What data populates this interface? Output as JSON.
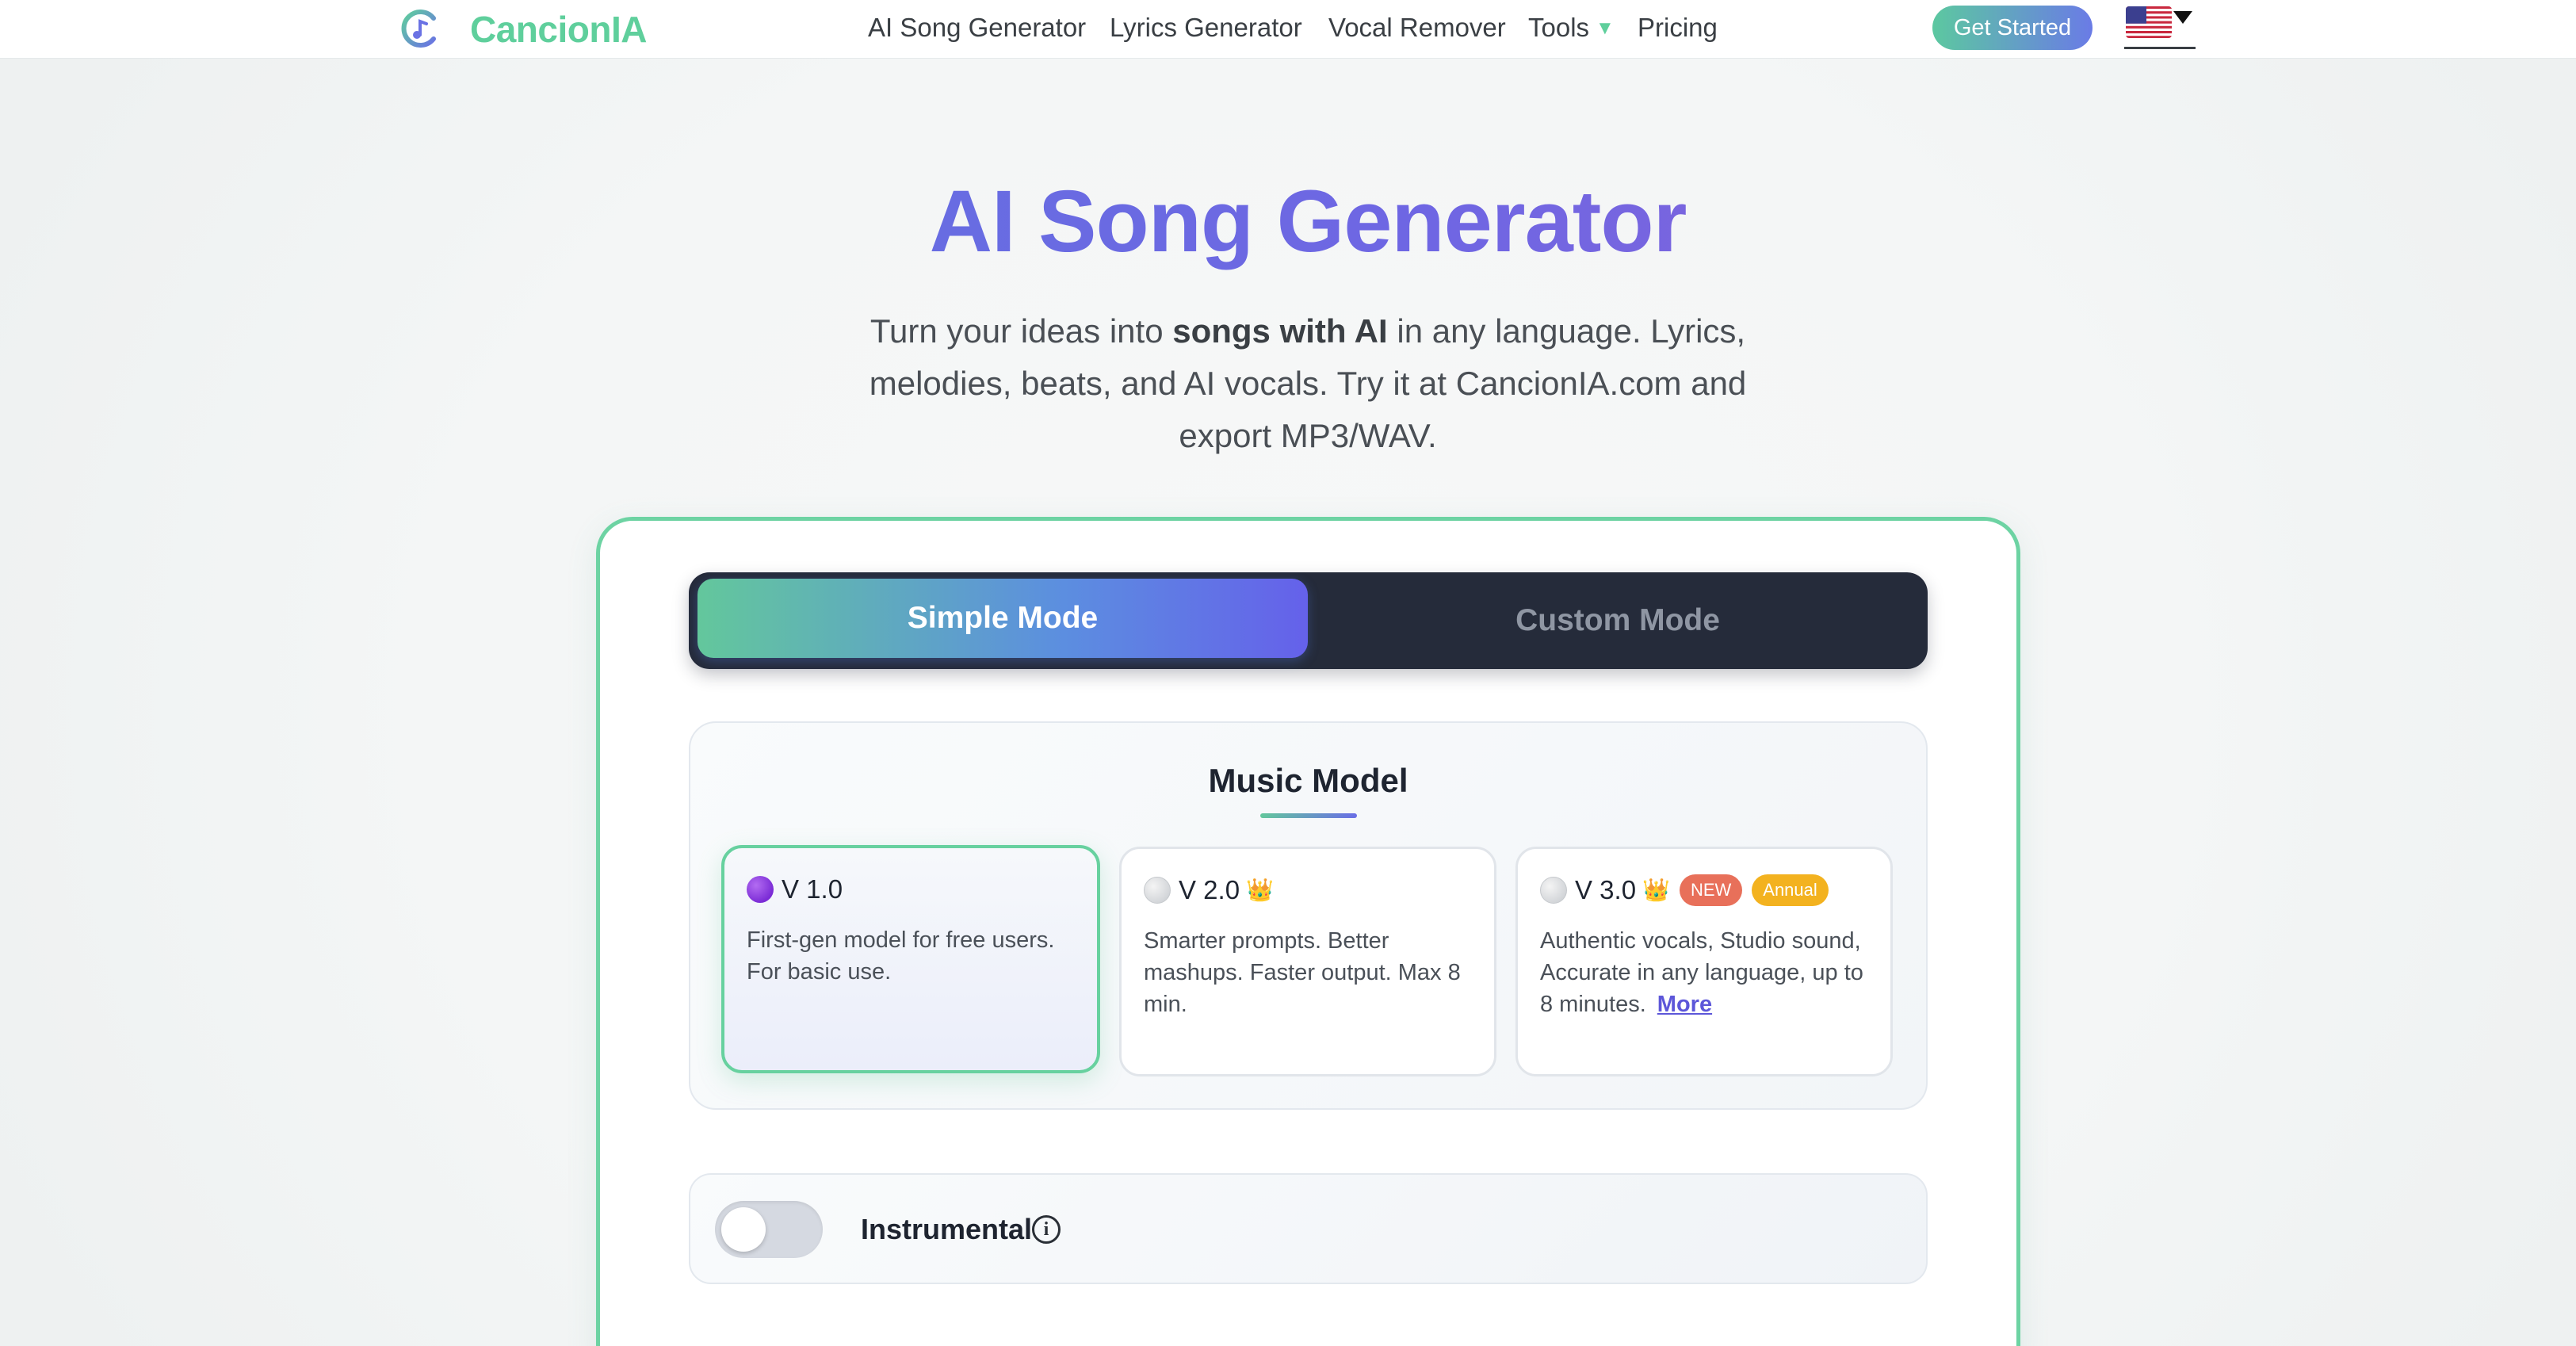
{
  "header": {
    "brand": "CancionIA",
    "nav": [
      "AI Song Generator",
      "Lyrics Generator",
      "Vocal Remover",
      "Tools",
      "Pricing"
    ],
    "cta": "Get Started",
    "language_icon": "us-flag-icon"
  },
  "hero": {
    "title": "AI Song Generator",
    "sub_part1": "Turn your ideas into ",
    "sub_bold": "songs with AI",
    "sub_part2": " in any language. Lyrics, melodies, beats, and AI vocals. Try it at CancionIA.com and export MP3/WAV."
  },
  "mode": {
    "simple": "Simple Mode",
    "custom": "Custom Mode",
    "selected": "Simple Mode"
  },
  "music_model": {
    "heading": "Music Model",
    "models": [
      {
        "name": "V 1.0",
        "desc": "First-gen model for free users. For basic use.",
        "selected": true
      },
      {
        "name": "V 2.0",
        "desc": "Smarter prompts. Better mashups. Faster output. Max 8 min.",
        "crown": "👑"
      },
      {
        "name": "V 3.0",
        "desc": "Authentic vocals, Studio sound, Accurate in any language, up to 8 minutes.",
        "crown": "👑",
        "badge_new": "NEW",
        "badge_annual": "Annual",
        "more": "More"
      }
    ]
  },
  "instrumental": {
    "label": "Instrumental",
    "enabled": false,
    "info": "i"
  },
  "colors": {
    "brand_green": "#5fcf9c",
    "accent_indigo": "#6561ea",
    "toggle_dark": "#252b3a"
  }
}
